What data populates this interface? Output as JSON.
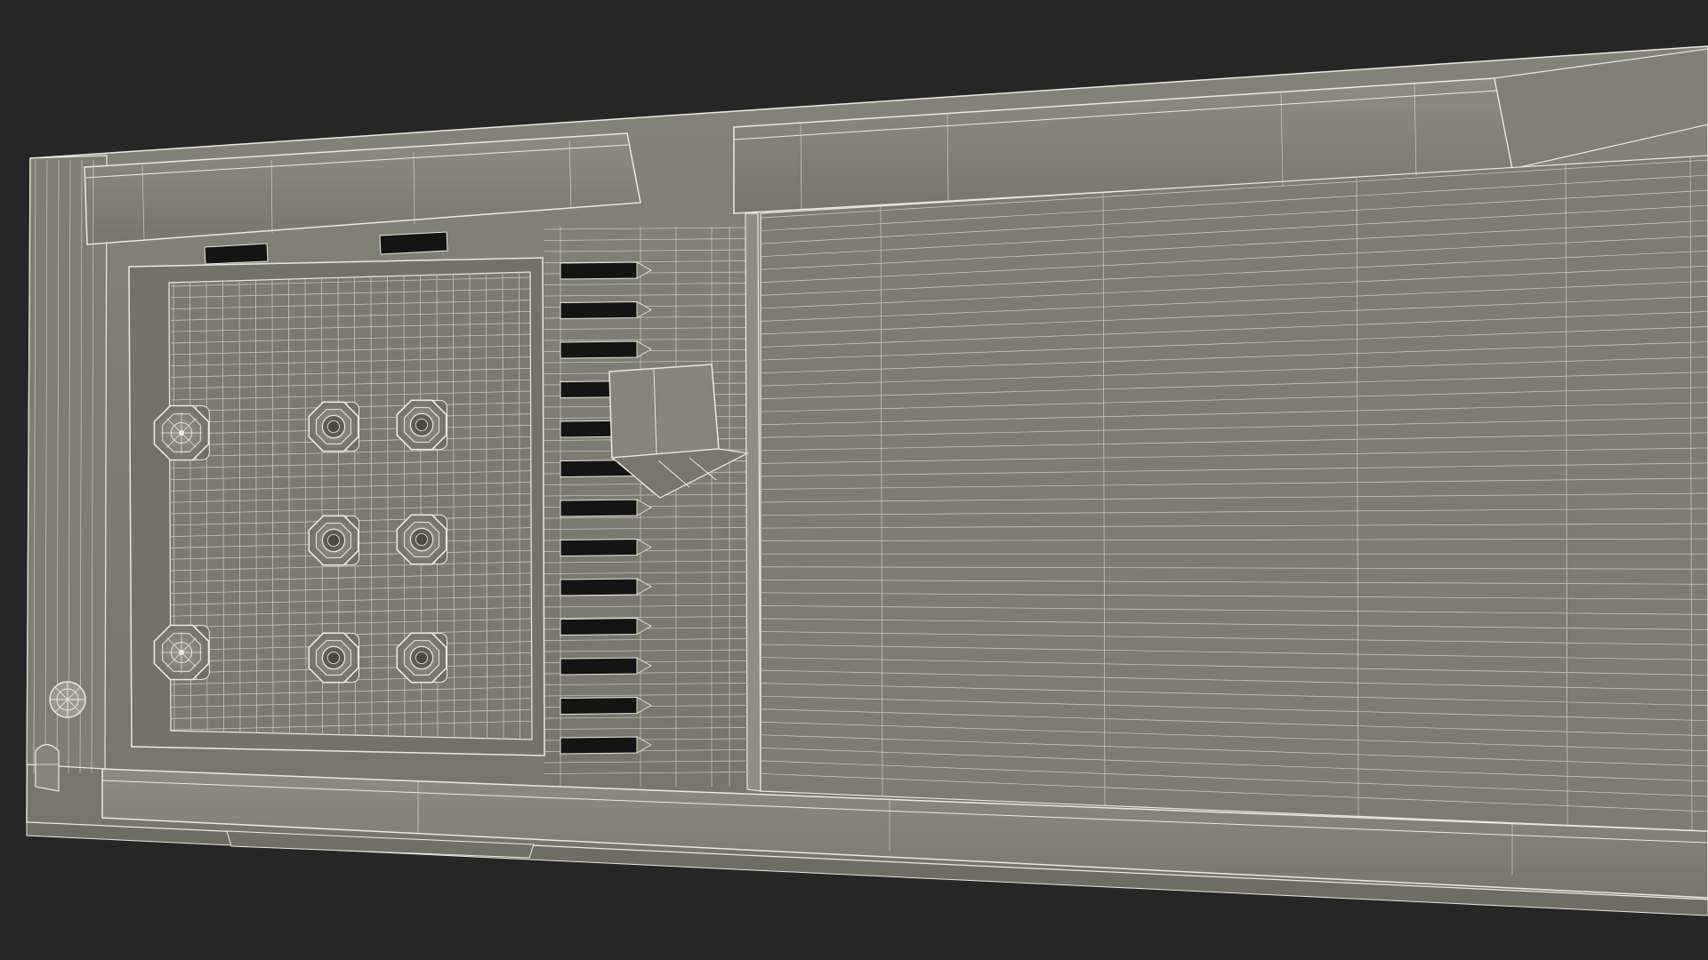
{
  "scene": {
    "subject": "wireframe-3d-device-rear-panel",
    "colors": {
      "background": "#262626",
      "surface": "#7b7b6f",
      "surface_light": "#86867a",
      "surface_dark": "#6c6c61",
      "wire": "#e9e9dc",
      "slot": "#141414",
      "port": "#d9d9cc"
    },
    "connectors": {
      "large_count": 2,
      "small_count": 6
    },
    "vent_slots": {
      "upper_count": 2,
      "column_count": 13
    },
    "icons": [
      "wire-mesh",
      "connector-jack",
      "vent-slot",
      "screw-head"
    ]
  }
}
